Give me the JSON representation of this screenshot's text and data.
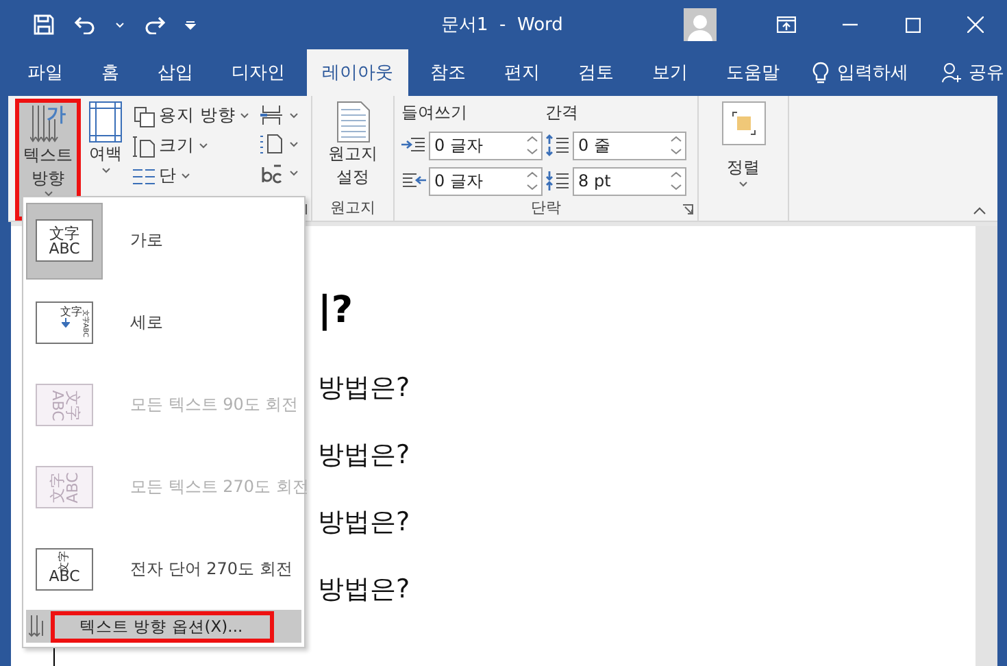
{
  "window": {
    "title": "문서1  -  Word"
  },
  "quick_access": [
    {
      "kind": "save"
    },
    {
      "kind": "undo"
    },
    {
      "kind": "dropdown"
    },
    {
      "kind": "redo"
    },
    {
      "kind": "customize"
    }
  ],
  "window_controls": [
    {
      "kind": "ribbon-display"
    },
    {
      "kind": "minimize"
    },
    {
      "kind": "maximize"
    },
    {
      "kind": "close"
    }
  ],
  "tabs": [
    {
      "label": "파일",
      "selected": false
    },
    {
      "label": "홈",
      "selected": false
    },
    {
      "label": "삽입",
      "selected": false
    },
    {
      "label": "디자인",
      "selected": false
    },
    {
      "label": "레이아웃",
      "selected": true
    },
    {
      "label": "참조",
      "selected": false
    },
    {
      "label": "편지",
      "selected": false
    },
    {
      "label": "검토",
      "selected": false
    },
    {
      "label": "보기",
      "selected": false
    },
    {
      "label": "도움말",
      "selected": false
    }
  ],
  "tell_me": {
    "placeholder": "입력하세"
  },
  "share": {
    "label": "공유"
  },
  "ribbon": {
    "text_direction": {
      "label_lines": [
        "텍스트",
        "방향"
      ],
      "glyph": "가",
      "pressed": true,
      "highlighted": true
    },
    "margins": {
      "label": "여백"
    },
    "page_setup_items": [
      {
        "kind": "orientation",
        "label": "용지 방향"
      },
      {
        "kind": "size",
        "label": "크기"
      },
      {
        "kind": "columns",
        "label": "단"
      }
    ],
    "page_setup_icons": [
      {
        "kind": "breaks"
      },
      {
        "kind": "line-numbers"
      },
      {
        "kind": "hyphenation"
      }
    ],
    "manuscript": {
      "label_lines": [
        "원고지",
        "설정"
      ],
      "group": "원고지"
    },
    "paragraph": {
      "group": "단락",
      "indent_title": "들여쓰기",
      "spacing_title": "간격",
      "fields": [
        {
          "kind": "indent-left",
          "value": "0 글자"
        },
        {
          "kind": "spacing-before",
          "value": "0 줄"
        },
        {
          "kind": "indent-right",
          "value": "0 글자"
        },
        {
          "kind": "spacing-after",
          "value": "8 pt"
        }
      ]
    },
    "arrange": {
      "label": "정렬"
    }
  },
  "document": {
    "heading": "|?",
    "lines": [
      "방법은?",
      "방법은?",
      "방법은?",
      "방법은?"
    ]
  },
  "menu": {
    "items": [
      {
        "kind": "horizontal",
        "label": "가로",
        "glyph_top": "文字",
        "glyph_bottom": "ABC",
        "selected": true,
        "disabled": false
      },
      {
        "kind": "vertical",
        "label": "세로",
        "glyph_top": "文字",
        "glyph_bottom": "文字ABC",
        "selected": false,
        "disabled": false
      },
      {
        "kind": "rotate90",
        "label": "모든 텍스트 90도 회전",
        "glyph_top": "文字",
        "glyph_bottom": "ABC",
        "selected": false,
        "disabled": true
      },
      {
        "kind": "rotate270",
        "label": "모든 텍스트 270도 회전",
        "glyph_top": "文字",
        "glyph_bottom": "ABC",
        "selected": false,
        "disabled": true
      },
      {
        "kind": "stacked270",
        "label": "전자 단어 270도 회전",
        "glyph_top": "文字",
        "glyph_bottom": "ABC",
        "selected": false,
        "disabled": false
      }
    ],
    "footer": {
      "label": "텍스트 방향 옵션(X)...",
      "highlighted": true
    }
  }
}
